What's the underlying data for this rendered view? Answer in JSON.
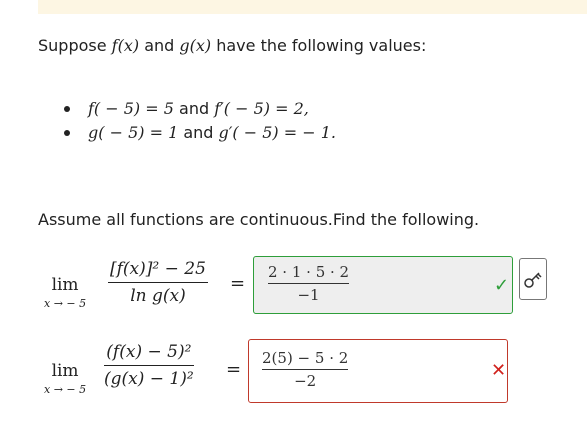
{
  "intro": {
    "text_before": "Suppose ",
    "f_expr": "f(x)",
    "and": " and ",
    "g_expr": "g(x)",
    "text_after": " have the following values:"
  },
  "values": [
    {
      "lhs": "f( − 5) = 5",
      "and": " and ",
      "rhs": "f′( − 5) = 2,"
    },
    {
      "lhs": "g( − 5) = 1",
      "and": " and ",
      "rhs": "g′( − 5) =  − 1."
    }
  ],
  "assume_text": "Assume all functions are continuous.Find the following.",
  "problems": [
    {
      "lim_word": "lim",
      "lim_sub": "x → − 5",
      "numerator": "[f(x)]² − 25",
      "denominator": "ln g(x)",
      "equals": "=",
      "answer_numerator": "2 · 1 · 5 · 2",
      "answer_denominator": "−1",
      "status": "correct",
      "status_icon": "check-icon"
    },
    {
      "lim_word": "lim",
      "lim_sub": "x → − 5",
      "numerator": "(f(x) − 5)²",
      "denominator": "(g(x) − 1)²",
      "equals": "=",
      "answer_numerator": "2(5) − 5 · 2",
      "answer_denominator": "−2",
      "status": "incorrect",
      "status_icon": "cross-icon"
    }
  ],
  "key_button_icon": "key-icon",
  "colors": {
    "correct": "#2e9e3a",
    "incorrect": "#d0211c",
    "banner": "#fdf6e3"
  }
}
